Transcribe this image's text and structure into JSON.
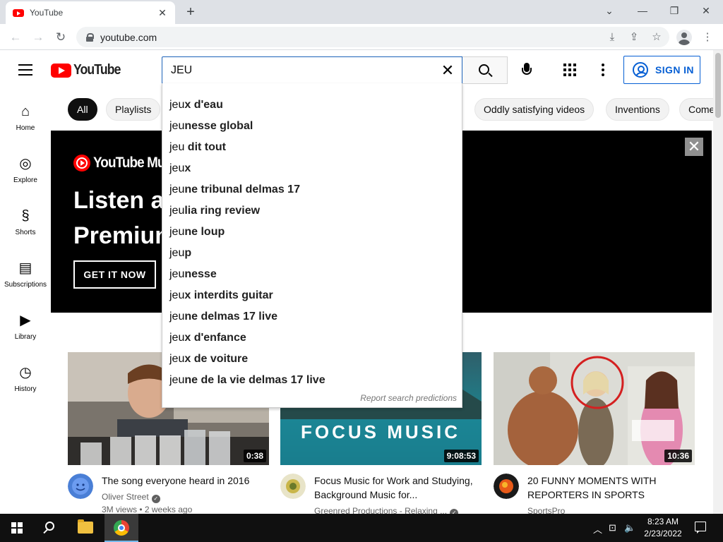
{
  "browser": {
    "tab_title": "YouTube",
    "tab_close": "✕",
    "new_tab": "+",
    "url": "youtube.com",
    "window_controls": {
      "chevron": "⌄",
      "minimize": "—",
      "restore": "❐",
      "close": "✕"
    },
    "nav": {
      "back": "←",
      "forward": "→",
      "reload": "↻"
    },
    "toolbar_icons": {
      "install": "⤓",
      "share": "⇪",
      "bookmark": "☆",
      "menu": "⋮"
    }
  },
  "youtube": {
    "logo_text": "YouTube",
    "search": {
      "query": "JEU",
      "clear": "✕"
    },
    "signin_label": "SIGN IN",
    "guide": [
      {
        "label": "Home",
        "icon": "⌂"
      },
      {
        "label": "Explore",
        "icon": "◎"
      },
      {
        "label": "Shorts",
        "icon": "§"
      },
      {
        "label": "Subscriptions",
        "icon": "▤"
      },
      {
        "label": "Library",
        "icon": "▶"
      },
      {
        "label": "History",
        "icon": "◷"
      }
    ],
    "chips": [
      "All",
      "Playlists",
      "Oddly satisfying videos",
      "Inventions",
      "Come"
    ],
    "suggestions": [
      {
        "prefix": "jeu",
        "rest": "x d'eau"
      },
      {
        "prefix": "jeu",
        "rest": "nesse global"
      },
      {
        "prefix": "jeu",
        "rest": " dit tout"
      },
      {
        "prefix": "jeu",
        "rest": "x"
      },
      {
        "prefix": "jeu",
        "rest": "ne tribunal delmas 17"
      },
      {
        "prefix": "jeu",
        "rest": "lia ring review"
      },
      {
        "prefix": "jeu",
        "rest": "ne loup"
      },
      {
        "prefix": "jeu",
        "rest": "p"
      },
      {
        "prefix": "jeu",
        "rest": "nesse"
      },
      {
        "prefix": "jeu",
        "rest": "x interdits guitar"
      },
      {
        "prefix": "jeu",
        "rest": "ne delmas 17 live"
      },
      {
        "prefix": "jeu",
        "rest": "x d'enfance"
      },
      {
        "prefix": "jeu",
        "rest": "x de voiture"
      },
      {
        "prefix": "jeu",
        "rest": "ne de la vie delmas 17 live"
      }
    ],
    "report_predictions": "Report search predictions",
    "banner": {
      "music_logo": "YouTube Music",
      "headline_1": "Listen ad",
      "headline_2": "Premium",
      "cta": "GET IT NOW",
      "close": "✕"
    },
    "videos": [
      {
        "duration": "0:38",
        "title": "The song everyone heard in 2016",
        "channel": "Oliver Street",
        "stats": "3M views • 2 weeks ago"
      },
      {
        "duration": "9:08:53",
        "title": "Focus Music for Work and Studying, Background Music for...",
        "channel": "Greenred Productions - Relaxing ...",
        "stats": "",
        "thumb_text": "FOCUS MUSIC"
      },
      {
        "duration": "10:36",
        "title": "20 FUNNY MOMENTS WITH REPORTERS IN SPORTS",
        "channel": "SportsPro",
        "stats": ""
      }
    ]
  },
  "taskbar": {
    "time": "8:23 AM",
    "date": "2/23/2022",
    "tray": {
      "chevron": "︿",
      "network": "⊡",
      "volume": "🔈"
    }
  },
  "colors": {
    "youtube_red": "#ff0000",
    "signin_blue": "#065fd4",
    "search_border": "#1c62b9"
  }
}
